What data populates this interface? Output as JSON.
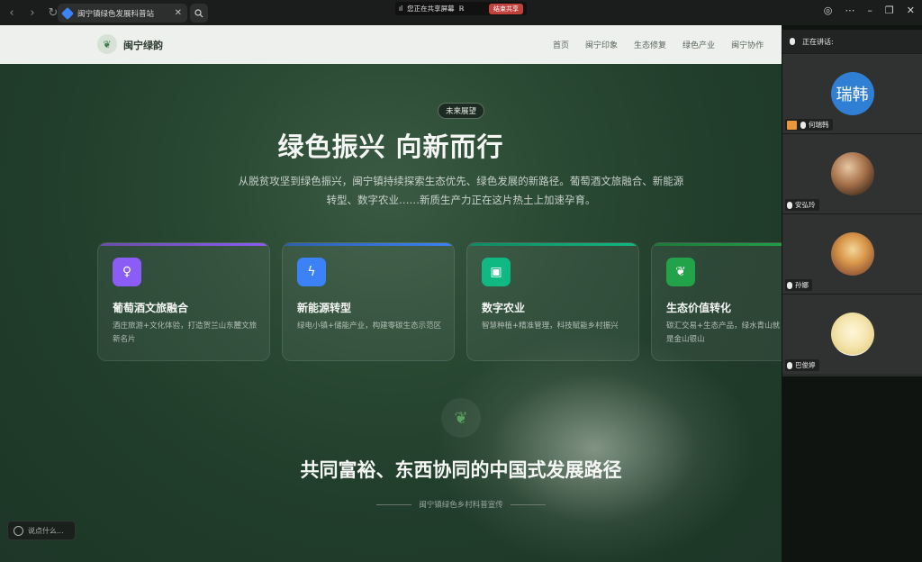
{
  "browser": {
    "tab_title": "闽宁镇绿色发展科普站",
    "share_status": "您正在共享屏幕",
    "share_stop_label": "结束共享"
  },
  "site": {
    "logo_text": "闽宁绿韵",
    "nav": [
      "首页",
      "闽宁印象",
      "生态修复",
      "绿色产业",
      "闽宁协作"
    ],
    "badge": "未来展望",
    "hero_title": "绿色振兴 向新而行",
    "hero_desc": "从脱贫攻坚到绿色振兴，闽宁镇持续探索生态优先、绿色发展的新路径。葡萄酒文旅融合、新能源转型、数字农业……新质生产力正在这片热土上加速孕育。",
    "cards": [
      {
        "title": "葡萄酒文旅融合",
        "desc": "酒庄旅游+文化体验，打造贺兰山东麓文旅新名片",
        "icon": "wine-glass-icon",
        "color": "#8b5cf6"
      },
      {
        "title": "新能源转型",
        "desc": "绿电小镇+储能产业，构建零碳生态示范区",
        "icon": "lightning-icon",
        "color": "#3b82f6"
      },
      {
        "title": "数字农业",
        "desc": "智慧种植+精准管理，科技赋能乡村振兴",
        "icon": "chip-icon",
        "color": "#10b981"
      },
      {
        "title": "生态价值转化",
        "desc": "碳汇交易+生态产品，绿水青山就是金山银山",
        "icon": "leaf-icon",
        "color": "#22a34a"
      }
    ],
    "sub_title": "共同富裕、东西协同的中国式发展路径",
    "sub_caption": "闽宁镇绿色乡村科普宣传",
    "chat_placeholder": "说点什么..."
  },
  "meeting": {
    "header": "正在讲话:",
    "participants": [
      {
        "name": "何瑞韩",
        "avatar_text": "瑞韩",
        "speaking": true
      },
      {
        "name": "安弘玲",
        "avatar_text": ""
      },
      {
        "name": "孙娜",
        "avatar_text": ""
      },
      {
        "name": "巴俊婷",
        "avatar_text": ""
      }
    ]
  }
}
